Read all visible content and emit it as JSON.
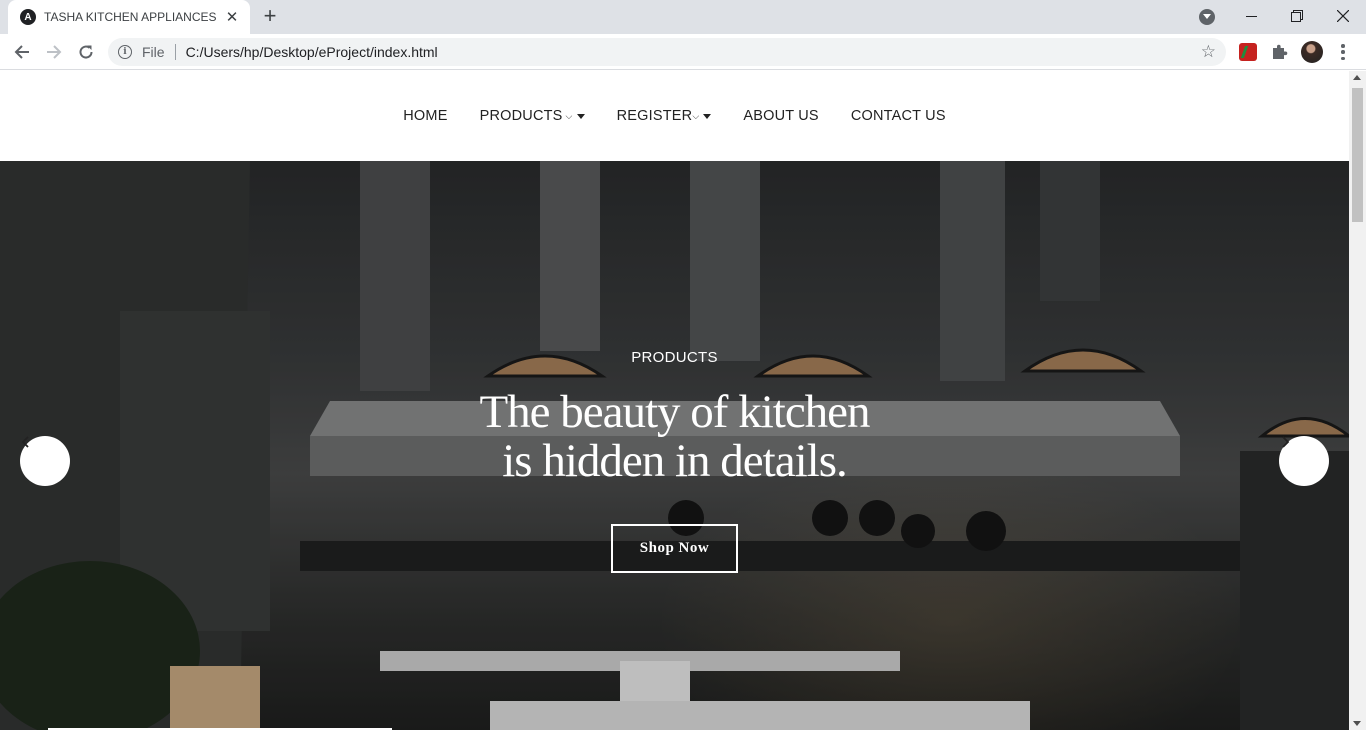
{
  "browser": {
    "tab_title": "TASHA KITCHEN APPLIANCES",
    "tab_favicon_letter": "A",
    "address_scheme_label": "File",
    "address_url": "C:/Users/hp/Desktop/eProject/index.html"
  },
  "navbar": {
    "items": [
      {
        "label": "HOME"
      },
      {
        "label": "PRODUCTS",
        "chevron": "⌵"
      },
      {
        "label": "REGISTER",
        "chevron": "⌵"
      },
      {
        "label": "ABOUT US"
      },
      {
        "label": "CONTACT US"
      }
    ]
  },
  "hero": {
    "subtitle": "PRODUCTS",
    "title_line1": "The beauty of kitchen",
    "title_line2": "is hidden in details.",
    "button_label": "Shop Now"
  },
  "colors": {
    "tabbar_bg": "#dee1e6",
    "hero_overlay": "#2a2c2d",
    "text_white": "#ffffff"
  }
}
